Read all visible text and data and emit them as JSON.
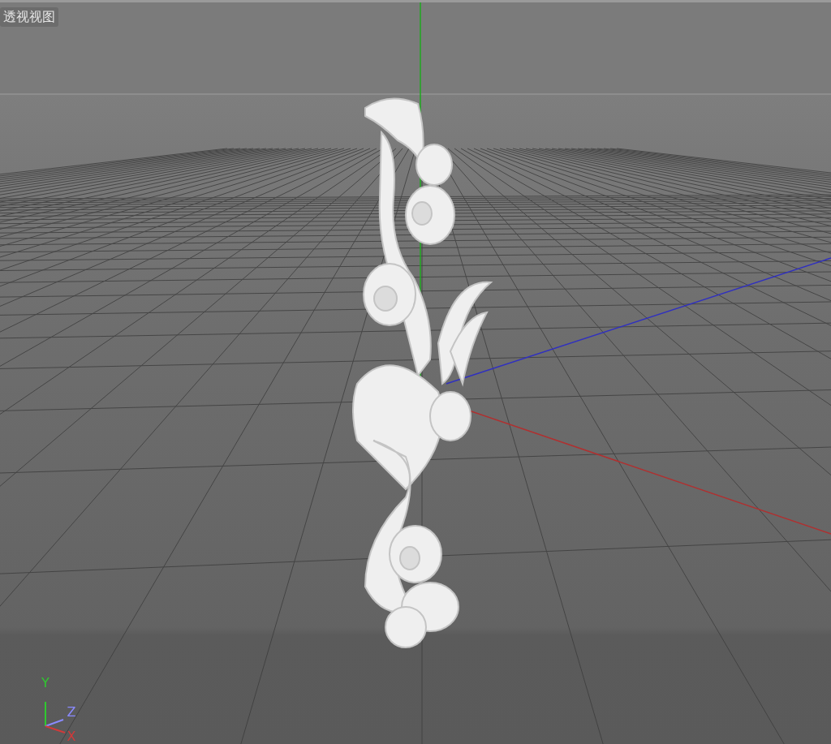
{
  "viewport": {
    "label": "透视视图"
  },
  "axis_gizmo": {
    "axes": [
      {
        "kind": "y",
        "text": "Y"
      },
      {
        "kind": "z",
        "text": "Z"
      },
      {
        "kind": "x",
        "text": "X"
      }
    ]
  }
}
